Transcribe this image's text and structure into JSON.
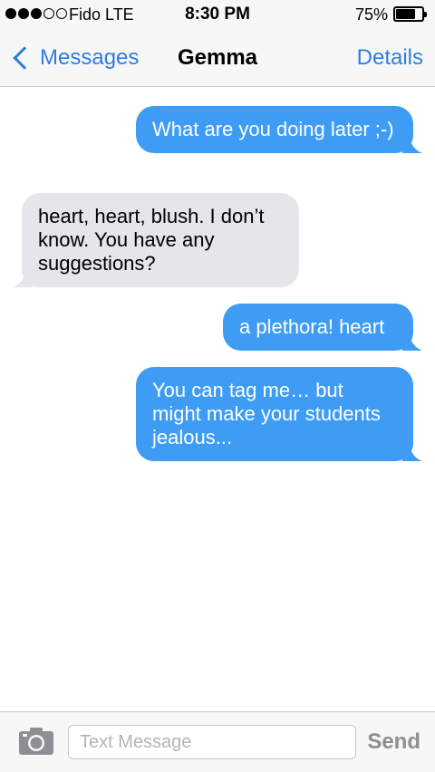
{
  "status_bar": {
    "carrier": "Fido  LTE",
    "time": "8:30 PM",
    "battery_percent": "75%",
    "battery_level": 0.75,
    "signal_strength": 3,
    "signal_max": 5
  },
  "nav": {
    "back_label": "Messages",
    "title": "Gemma",
    "details_label": "Details"
  },
  "messages": [
    {
      "direction": "outgoing",
      "text": "What are you doing later ;-)"
    },
    {
      "direction": "incoming",
      "text": "heart, heart, blush. I don’t know. You have any suggestions?"
    },
    {
      "direction": "outgoing",
      "text": "a plethora! heart"
    },
    {
      "direction": "outgoing",
      "text": "You can tag me… but might make your students jealous..."
    }
  ],
  "input_bar": {
    "placeholder": "Text Message",
    "value": "",
    "send_label": "Send",
    "camera_icon": "camera-icon"
  },
  "colors": {
    "accent": "#2f7de1",
    "outgoing_bubble": "#3e9cf5",
    "incoming_bubble": "#e5e5ea",
    "send_disabled": "#8e8e93"
  }
}
